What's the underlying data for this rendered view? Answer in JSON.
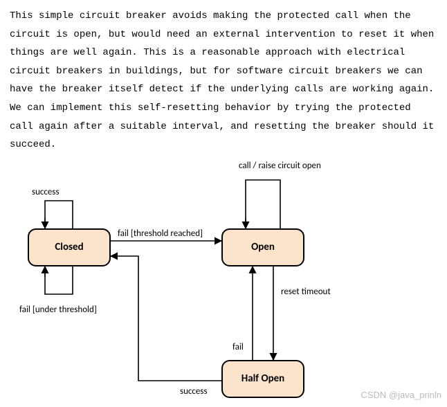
{
  "paragraph": "This simple circuit breaker avoids making the protected call when the circuit is open, but would need an external intervention to reset it when things are well again. This is a reasonable approach with electrical circuit breakers in buildings, but for software circuit breakers we can have the breaker itself detect if the underlying calls are working again. We can implement this self-resetting behavior by trying the protected call again after a suitable interval, and resetting the breaker should it succeed.",
  "states": {
    "closed": "Closed",
    "open": "Open",
    "half_open": "Half Open"
  },
  "edges": {
    "closed_self_top": "success",
    "closed_self_bottom": "fail [under threshold]",
    "closed_to_open": "fail [threshold reached]",
    "open_self": "call / raise circuit open",
    "open_to_half": "reset timeout",
    "half_to_open": "fail",
    "half_to_closed": "success"
  },
  "watermark": "CSDN @java_prinln"
}
